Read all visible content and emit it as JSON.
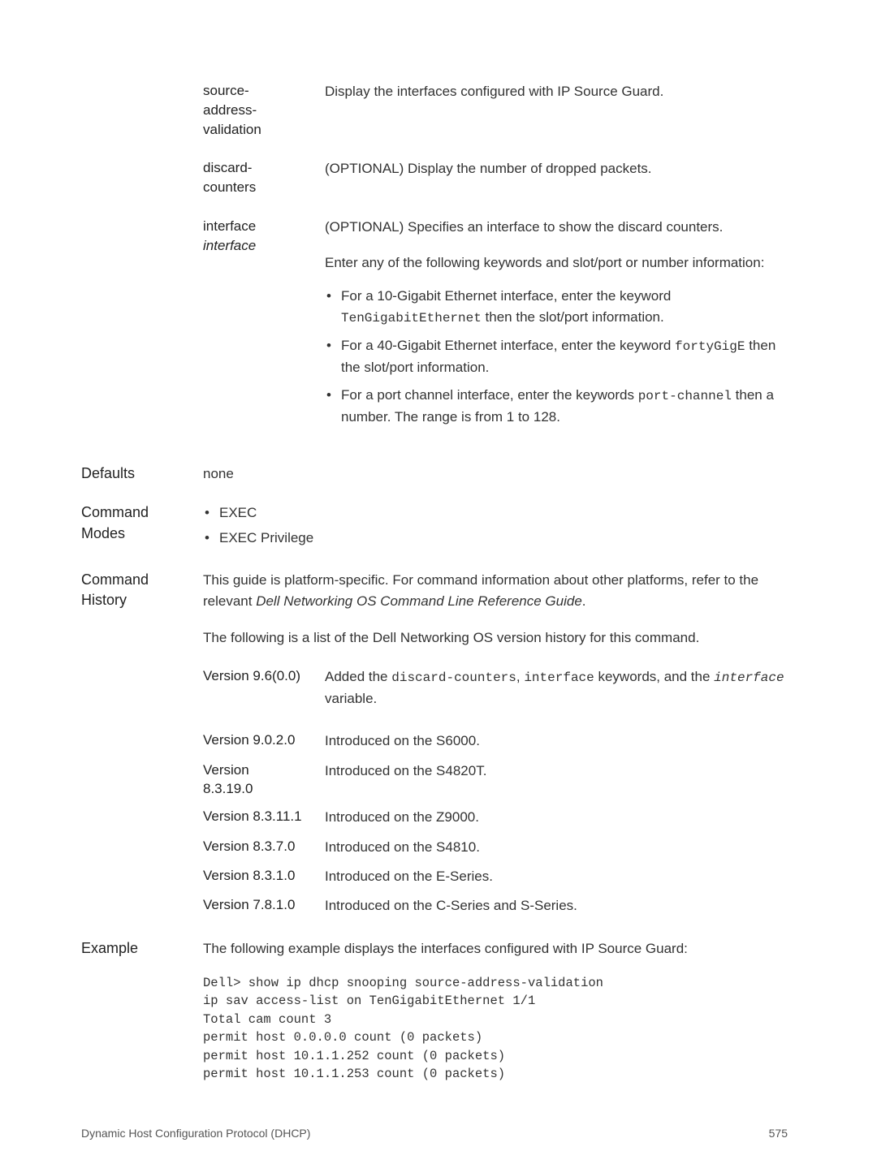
{
  "params": {
    "p1": {
      "l1": "source-",
      "l2": "address-",
      "l3": "validation",
      "desc": "Display the interfaces configured with IP Source Guard."
    },
    "p2": {
      "l1": "discard-",
      "l2": "counters",
      "desc": "(OPTIONAL) Display the number of dropped packets."
    },
    "p3": {
      "l1": "interface",
      "l2": "interface",
      "desc": "(OPTIONAL) Specifies an interface to show the discard counters.",
      "desc2": "Enter any of the following keywords and slot/port or number information:",
      "b1a": "For a 10-Gigabit Ethernet interface, enter the keyword ",
      "b1b": "TenGigabitEthernet",
      "b1c": " then the slot/port information.",
      "b2a": "For a 40-Gigabit Ethernet interface, enter the keyword ",
      "b2b": "fortyGigE",
      "b2c": " then the slot/port information.",
      "b3a": "For a port channel interface, enter the keywords ",
      "b3b": "port-channel",
      "b3c": " then a number. The range is from 1 to 128."
    }
  },
  "defaults": {
    "label": "Defaults",
    "value": "none"
  },
  "cmdmodes": {
    "label1": "Command",
    "label2": "Modes",
    "i1": "EXEC",
    "i2": "EXEC Privilege"
  },
  "cmdhistory": {
    "label1": "Command",
    "label2": "History",
    "p1a": "This guide is platform-specific. For command information about other platforms, refer to the relevant ",
    "p1b": "Dell Networking OS Command Line Reference Guide",
    "p1c": ".",
    "p2": "The following is a list of the Dell Networking OS version history for this command.",
    "versions": [
      {
        "v": "Version 9.6(0.0)",
        "d1": "Added the ",
        "d2": "discard-counters",
        "d3": ", ",
        "d4": "interface",
        "d5": " keywords, and the ",
        "d6": "interface",
        "d7": " variable."
      },
      {
        "v": "Version 9.0.2.0",
        "d": "Introduced on the S6000."
      },
      {
        "v1": "Version",
        "v2": "8.3.19.0",
        "d": "Introduced on the S4820T."
      },
      {
        "v": "Version 8.3.11.1",
        "d": "Introduced on the Z9000."
      },
      {
        "v": "Version 8.3.7.0",
        "d": "Introduced on the S4810."
      },
      {
        "v": "Version 8.3.1.0",
        "d": "Introduced on the E-Series."
      },
      {
        "v": "Version 7.8.1.0",
        "d": "Introduced on the C-Series and S-Series."
      }
    ]
  },
  "example": {
    "label": "Example",
    "intro": "The following example displays the interfaces configured with IP Source Guard:",
    "code": "Dell> show ip dhcp snooping source-address-validation\nip sav access-list on TenGigabitEthernet 1/1\nTotal cam count 3\npermit host 0.0.0.0 count (0 packets)\npermit host 10.1.1.252 count (0 packets)\npermit host 10.1.1.253 count (0 packets)"
  },
  "footer": {
    "left": "Dynamic Host Configuration Protocol (DHCP)",
    "right": "575"
  }
}
